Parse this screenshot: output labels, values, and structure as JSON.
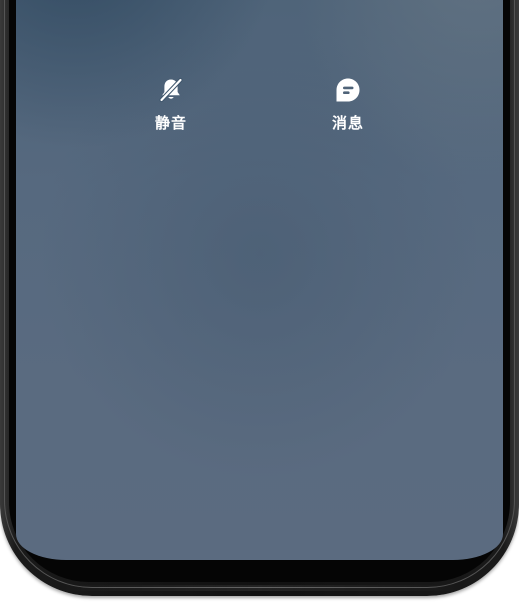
{
  "lockscreen": {
    "shortcuts": [
      {
        "label": "静音",
        "icon": "bell-off-icon"
      },
      {
        "label": "消息",
        "icon": "message-icon"
      }
    ]
  },
  "colors": {
    "screen_top": "#4a6075",
    "screen_bottom": "#5b6b80",
    "frame": "#111111",
    "icon": "#ffffff"
  }
}
